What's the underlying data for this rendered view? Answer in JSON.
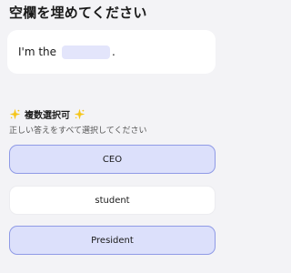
{
  "prompt": "空欄を埋めてください",
  "sentence": {
    "before": "I'm the",
    "after": "."
  },
  "section": {
    "title": "複数選択可",
    "subtitle": "正しい答えをすべて選択してください"
  },
  "options": [
    {
      "label": "CEO",
      "selected": true
    },
    {
      "label": "student",
      "selected": false
    },
    {
      "label": "President",
      "selected": true
    }
  ],
  "colors": {
    "selected_bg": "#dce0fb",
    "selected_border": "#8f9ae6",
    "blank": "#e3e5fb",
    "sparkle": "#f5c518"
  }
}
